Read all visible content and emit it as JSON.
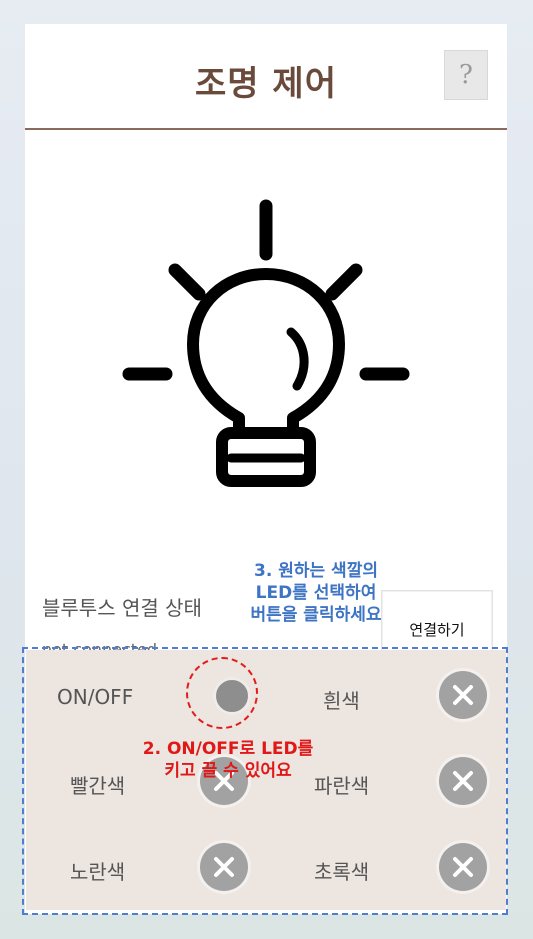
{
  "header": {
    "title": "조명 제어",
    "help_label": "?"
  },
  "bluetooth": {
    "label": "블루투스 연결 상태",
    "status": "not connected",
    "connect_button": "연결하기"
  },
  "controls": {
    "onoff_label": "ON/OFF",
    "colors": [
      {
        "label": "흰색",
        "icon": "x-icon"
      },
      {
        "label": "빨간색",
        "icon": "x-icon"
      },
      {
        "label": "파란색",
        "icon": "x-icon"
      },
      {
        "label": "노란색",
        "icon": "x-icon"
      },
      {
        "label": "초록색",
        "icon": "x-icon"
      }
    ]
  },
  "annotations": {
    "blue": [
      "3. 원하는 색깔의",
      "LED를 선택하여",
      "버튼을 클릭하세요"
    ],
    "red": [
      "2. ON/OFF로 LED를",
      "키고 끌 수 있어요"
    ]
  },
  "colors": {
    "title": "#6a4a3a",
    "divider": "#8b6c5c",
    "panel_bg": "#ece5e0",
    "annotation_blue": "#3e74c4",
    "annotation_red": "#e01818"
  }
}
